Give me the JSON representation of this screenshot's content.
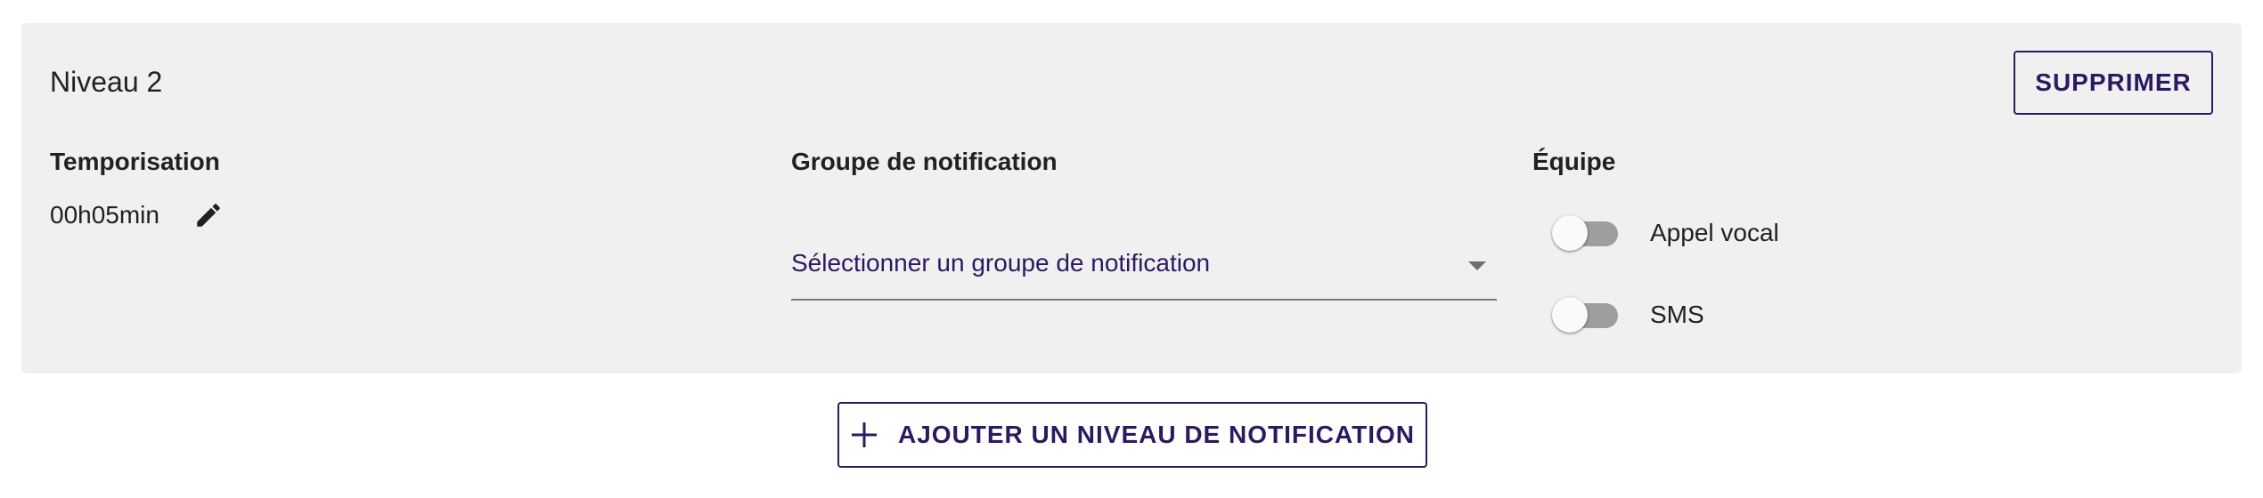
{
  "level": {
    "title": "Niveau 2",
    "delete_label": "SUPPRIMER"
  },
  "timer": {
    "label": "Temporisation",
    "value": "00h05min",
    "edit_icon": "pencil-icon"
  },
  "notification_group": {
    "label": "Groupe de notification",
    "placeholder": "Sélectionner un groupe de notification"
  },
  "team": {
    "label": "Équipe",
    "toggles": [
      {
        "label": "Appel vocal",
        "on": false
      },
      {
        "label": "SMS",
        "on": false
      }
    ]
  },
  "add_level": {
    "label": "AJOUTER UN NIVEAU DE NOTIFICATION",
    "icon": "plus-icon"
  },
  "colors": {
    "accent": "#2b1a62",
    "card_background": "#f0f0f0",
    "toggle_track_off": "#9e9e9e"
  }
}
